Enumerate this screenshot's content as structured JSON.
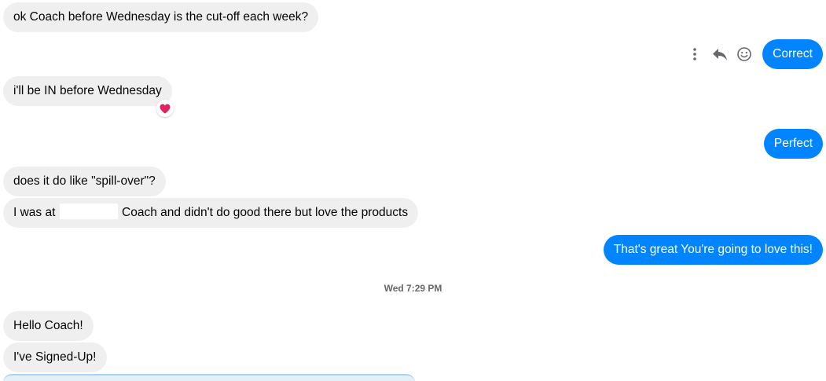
{
  "messages": {
    "m1": "ok Coach before Wednesday is the cut-off each week?",
    "m2": "Correct",
    "m3": "i'll be IN before Wednesday",
    "m4": "Perfect",
    "m5": "does it do like \"spill-over\"?",
    "m6_before": "I was at",
    "m6_after": "Coach and didn't do good there but love the products",
    "m7": "That's great You're going to love this!",
    "m8": "Hello Coach!",
    "m9": "I've Signed-Up!"
  },
  "timestamp": "Wed 7:29 PM",
  "reactions": {
    "m3": "heart"
  },
  "hover_actions": [
    "more-icon",
    "reply-icon",
    "emoji-react-icon"
  ],
  "colors": {
    "incoming_bubble": "#efefef",
    "outgoing_bubble": "#0084ff",
    "incoming_text": "#050505",
    "outgoing_text": "#ffffff",
    "timestamp": "#65676b",
    "heart": "#e0245e"
  }
}
